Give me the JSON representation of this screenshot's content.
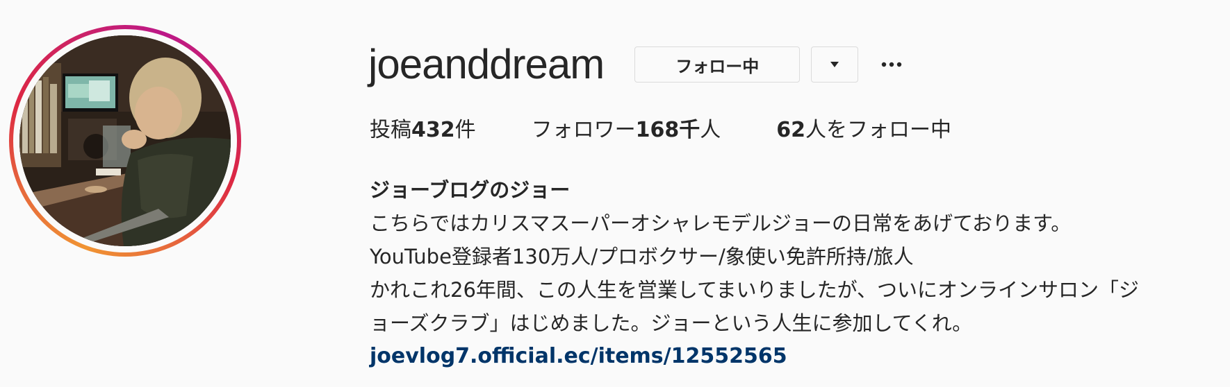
{
  "profile": {
    "username": "joeanddream",
    "following_button_label": "フォロー中",
    "more_label": "…",
    "stats": {
      "posts_prefix": "投稿",
      "posts_count": "432",
      "posts_suffix": "件",
      "followers_prefix": "フォロワー",
      "followers_count": "168千",
      "followers_suffix": "人",
      "following_count": "62",
      "following_suffix": "人をフォロー中"
    },
    "bio": {
      "full_name": "ジョーブログのジョー",
      "line1": "こちらではカリスマスーパーオシャレモデルジョーの日常をあげております。",
      "line2": "YouTube登録者130万人/プロボクサー/象使い免許所持/旅人",
      "line3": "かれこれ26年間、この人生を営業してまいりましたが、ついにオンラインサロン「ジ",
      "line4": "ョーズクラブ」はじめました。ジョーという人生に参加してくれ。",
      "link": "joevlog7.official.ec/items/12552565"
    }
  },
  "colors": {
    "text": "#262626",
    "link": "#003569",
    "border": "#dbdbdb",
    "background": "#fafafa",
    "ring_start": "#f09433",
    "ring_end": "#bc1888"
  },
  "icons": {
    "dropdown": "chevron-down-icon",
    "more": "more-options-icon",
    "avatar": "profile-avatar"
  }
}
